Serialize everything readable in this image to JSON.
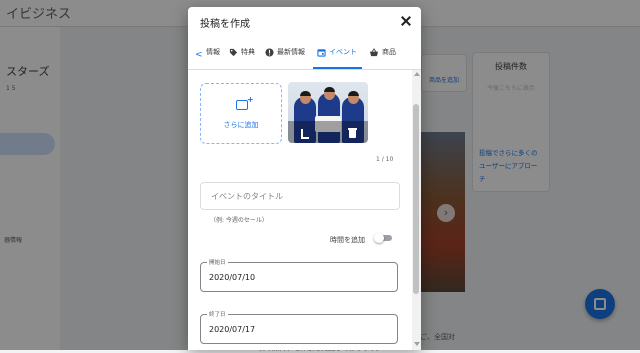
{
  "background": {
    "app_title": "イビジネス",
    "business_name": "スターズ",
    "business_small": "1 5",
    "side_label": "器情報",
    "shop_card_label": "商品を追加",
    "stats_card": {
      "title": "投稿件数",
      "sub": "今後こちらに表示",
      "link": "投稿でさらに多くのユーザーにアプローチ"
    },
    "bottom_text_1": "ご、全国対",
    "bottom_text_2": "次の無料デモ体験を実施しております。",
    "fab_icon": "post-icon"
  },
  "dialog": {
    "title": "投稿を作成",
    "close_icon": "close-icon",
    "tabs": [
      {
        "label": "情報",
        "icon": "chevron-left-icon"
      },
      {
        "label": "特典",
        "icon": "tag-icon"
      },
      {
        "label": "最新情報",
        "icon": "alert-icon"
      },
      {
        "label": "イベント",
        "icon": "calendar-icon"
      },
      {
        "label": "商品",
        "icon": "basket-icon"
      }
    ],
    "active_tab": "イベント",
    "add_more_label": "さらに追加",
    "photo_counter": "1 / 10",
    "event_title_placeholder": "イベントのタイトル",
    "event_title_helper": "（例: 今週のセール）",
    "add_time_label": "時間を追加",
    "add_time_enabled": false,
    "start_date_label": "開始日",
    "start_date_value": "2020/07/10",
    "end_date_label": "終了日",
    "end_date_value": "2020/07/17"
  },
  "colors": {
    "accent": "#1a73e8",
    "scrim": "#000000"
  }
}
